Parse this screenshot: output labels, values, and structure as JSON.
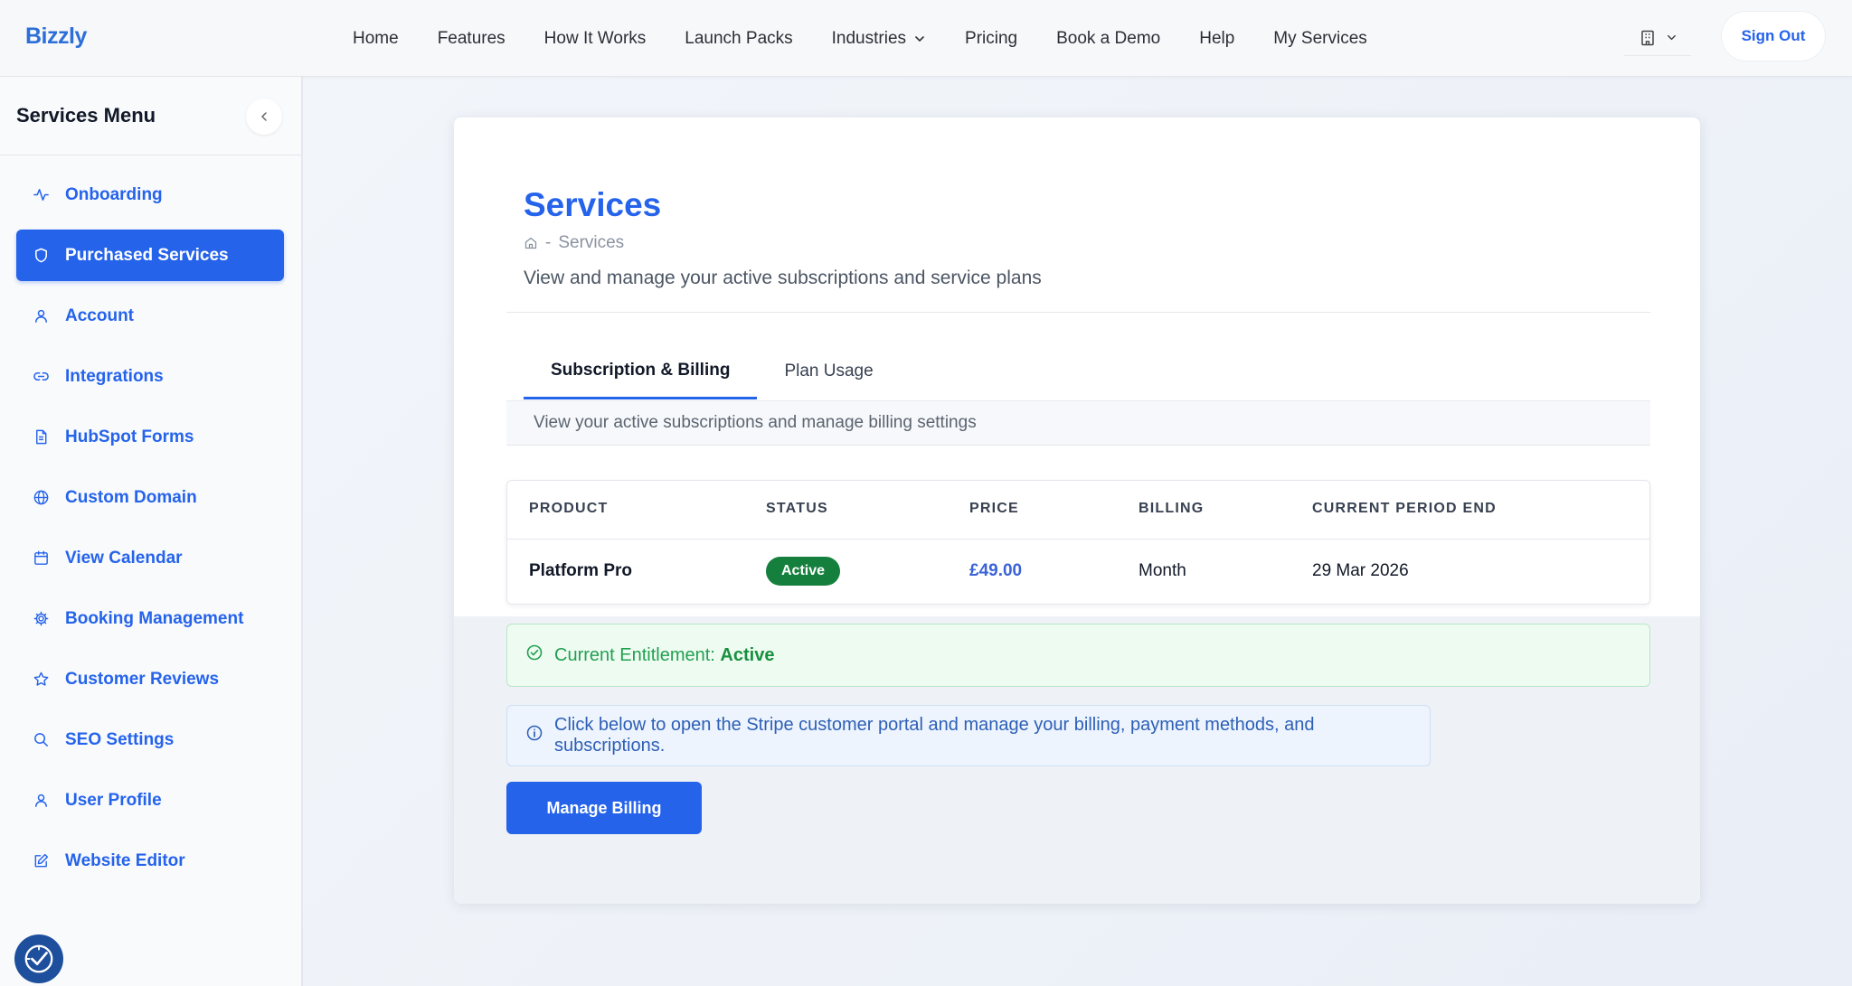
{
  "header": {
    "logo": "Bizzly",
    "nav": [
      {
        "label": "Home"
      },
      {
        "label": "Features"
      },
      {
        "label": "How It Works"
      },
      {
        "label": "Launch Packs"
      },
      {
        "label": "Industries"
      },
      {
        "label": "Pricing"
      },
      {
        "label": "Book a Demo"
      },
      {
        "label": "Help"
      },
      {
        "label": "My Services"
      }
    ],
    "sign_out": "Sign Out"
  },
  "sidebar": {
    "title": "Services Menu",
    "items": [
      {
        "label": "Onboarding",
        "icon": "activity-icon",
        "active": false
      },
      {
        "label": "Purchased Services",
        "icon": "shield-icon",
        "active": true
      },
      {
        "label": "Account",
        "icon": "user-icon",
        "active": false
      },
      {
        "label": "Integrations",
        "icon": "link-icon",
        "active": false
      },
      {
        "label": "HubSpot Forms",
        "icon": "document-icon",
        "active": false
      },
      {
        "label": "Custom Domain",
        "icon": "globe-icon",
        "active": false
      },
      {
        "label": "View Calendar",
        "icon": "calendar-icon",
        "active": false
      },
      {
        "label": "Booking Management",
        "icon": "gear-icon",
        "active": false
      },
      {
        "label": "Customer Reviews",
        "icon": "star-icon",
        "active": false
      },
      {
        "label": "SEO Settings",
        "icon": "search-icon",
        "active": false
      },
      {
        "label": "User Profile",
        "icon": "user-icon",
        "active": false
      },
      {
        "label": "Website Editor",
        "icon": "edit-icon",
        "active": false
      }
    ]
  },
  "main": {
    "title": "Services",
    "breadcrumb": {
      "separator": "-",
      "current": "Services"
    },
    "subtitle": "View and manage your active subscriptions and service plans",
    "tabs": [
      {
        "label": "Subscription & Billing",
        "active": true
      },
      {
        "label": "Plan Usage",
        "active": false
      }
    ],
    "tab_description": "View your active subscriptions and manage billing settings",
    "table": {
      "columns": [
        "PRODUCT",
        "STATUS",
        "PRICE",
        "BILLING",
        "CURRENT PERIOD END"
      ],
      "rows": [
        {
          "product": "Platform Pro",
          "status": "Active",
          "price": "£49.00",
          "billing": "Month",
          "period_end": "29 Mar 2026"
        }
      ]
    },
    "entitlement": {
      "label": "Current Entitlement:",
      "value": "Active"
    },
    "info": "Click below to open the Stripe customer portal and manage your billing, payment methods, and subscriptions.",
    "manage_button": "Manage Billing"
  },
  "colors": {
    "accent": "#2563eb",
    "success": "#15803d",
    "info_text": "#2d5fb6"
  }
}
